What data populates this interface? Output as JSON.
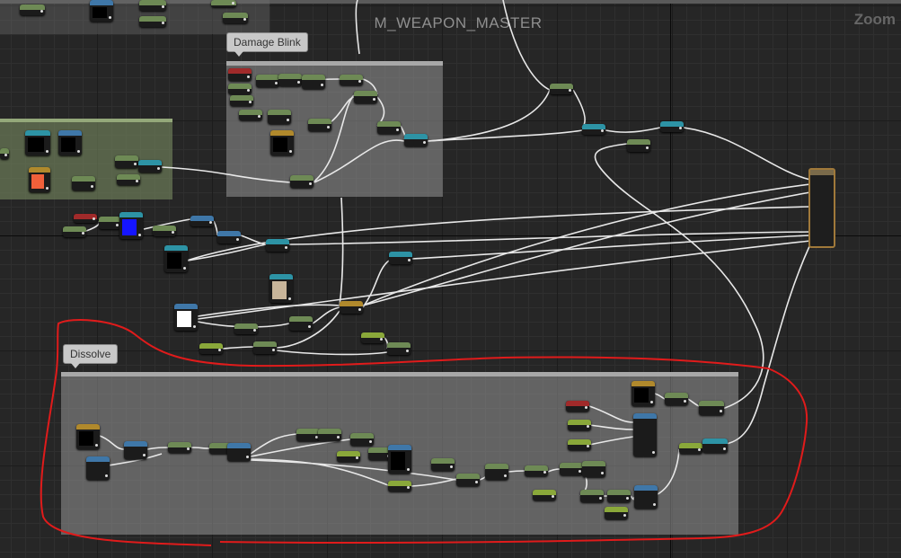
{
  "graph": {
    "title": "M_WEAPON_MASTER",
    "zoom_label": "Zoom"
  },
  "comments": {
    "damage_blink": "Damage Blink",
    "dissolve": "Dissolve"
  },
  "colors": {
    "wire": "#e8e8e8",
    "annotation": "#e01b1b",
    "comment_box": "#9a9a9a"
  },
  "icons": {
    "output": "material-output-node"
  }
}
